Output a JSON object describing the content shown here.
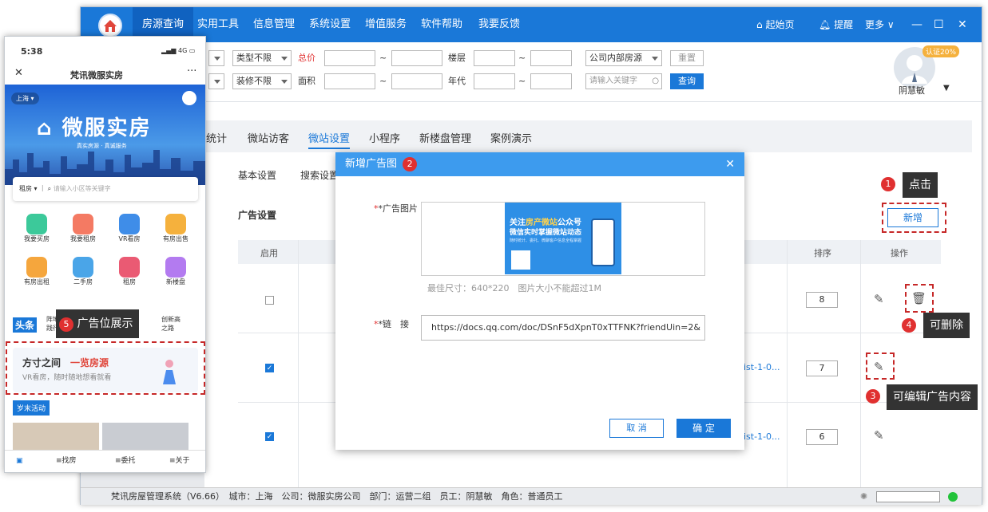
{
  "app": {
    "menu": [
      "房源查询",
      "实用工具",
      "信息管理",
      "系统设置",
      "增值服务",
      "软件帮助",
      "我要反馈"
    ],
    "right": {
      "home": "起始页",
      "remind": "提醒",
      "more": "更多"
    }
  },
  "filters": {
    "type": "类型不限",
    "decor": "装修不限",
    "total_price": "总价",
    "area": "面积",
    "floor": "楼层",
    "year": "年代",
    "tilde": "~",
    "source": "公司内部房源",
    "reset": "重置",
    "keyword_ph": "请输入关键字",
    "query": "查询"
  },
  "user": {
    "badge": "认证20%",
    "name": "阴慧敏"
  },
  "tabs": [
    "统计",
    "微站访客",
    "微站设置",
    "小程序",
    "新楼盘管理",
    "案例演示"
  ],
  "subtabs": [
    "基本设置",
    "搜索设置"
  ],
  "section": {
    "title": "广告设置",
    "add": "新增"
  },
  "table": {
    "headers": {
      "enable": "启用",
      "sort": "排序",
      "ops": "操作"
    },
    "rows": [
      {
        "link": "",
        "sort": "8"
      },
      {
        "link": "ist-1-0...",
        "sort": "7"
      },
      {
        "link": "ist-1-0...",
        "sort": "6"
      }
    ]
  },
  "modal": {
    "title": "新增广告图",
    "num": "2",
    "img_label": "*广告图片",
    "hint": "最佳尺寸：640*220　图片大小不能超过1M",
    "link_label": "*链　接",
    "link_value": "https://docs.qq.com/doc/DSnF5dXpnT0xTTFNK?friendUin=2&",
    "cancel": "取 消",
    "ok": "确 定",
    "banner": {
      "line1a": "关注",
      "line1b": "房产微站",
      "line1c": "公众号",
      "line2": "微信实时掌握微站动态",
      "line3": "随时统计、委托、微聊客户信息全程掌握"
    }
  },
  "callouts": {
    "c1": {
      "num": "1",
      "text": "点击"
    },
    "c3": {
      "num": "3",
      "text": "可编辑广告内容"
    },
    "c4": {
      "num": "4",
      "text": "可删除"
    },
    "c5": {
      "num": "5",
      "text": "广告位展示"
    }
  },
  "status": {
    "text": "梵讯房屋管理系统（V6.66）　城市：上海　公司：微服实房公司　部门：运营二组　员工：阴慧敏　角色：普通员工"
  },
  "phone": {
    "time": "5:38",
    "signal": "4G",
    "title": "梵讯微服实房",
    "close": "✕",
    "more": "···",
    "city": "上海",
    "hero": "微服实房",
    "slogan": "真实房源 · 真诚服务",
    "search_type": "租房",
    "search_ph": "请输入小区等关键字",
    "icons": [
      {
        "label": "我要买房",
        "color": "#3cc99a"
      },
      {
        "label": "我要租房",
        "color": "#f47a63"
      },
      {
        "label": "VR看房",
        "color": "#3f8de8"
      },
      {
        "label": "有房出售",
        "color": "#f5b13d"
      },
      {
        "label": "有房出租",
        "color": "#f5a63d"
      },
      {
        "label": "二手房",
        "color": "#4aa5e8"
      },
      {
        "label": "租房",
        "color": "#ea5a73"
      },
      {
        "label": "新楼盘",
        "color": "#b37bf0"
      }
    ],
    "news_tag": "头条",
    "news_text1": "阵地",
    "news_text2": "践行",
    "news_text3": "创新高",
    "news_text4": "之路",
    "ad_title1": "方寸之间",
    "ad_title2": "一览房源",
    "ad_sub": "VR看房，随时随地想看就看",
    "activity": "岁末活动",
    "nav": [
      "找房",
      "委托",
      "关于"
    ]
  }
}
